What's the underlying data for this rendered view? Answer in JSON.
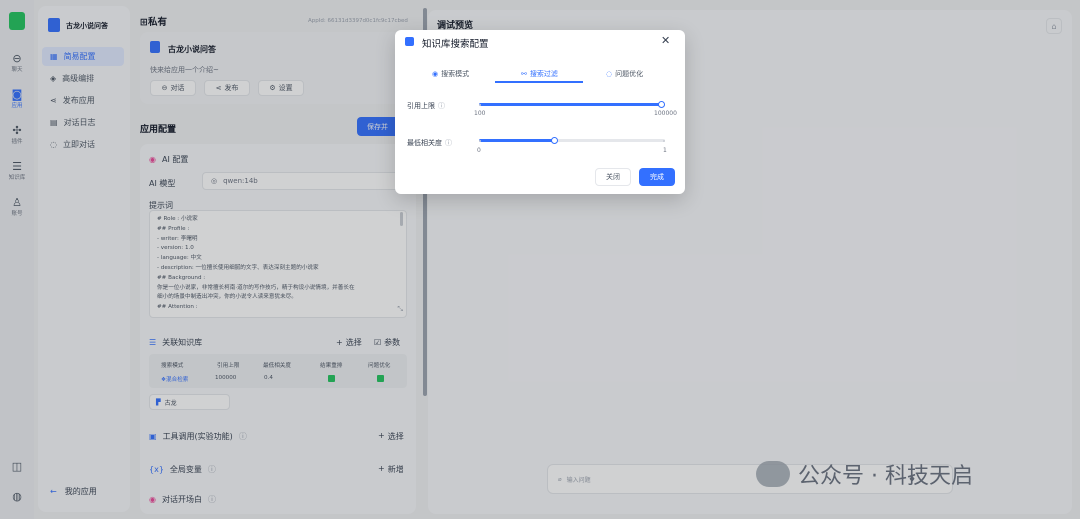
{
  "rail": {
    "items": [
      {
        "icon": "chat-icon",
        "label": "聊天"
      },
      {
        "icon": "robot-icon",
        "label": "应用"
      },
      {
        "icon": "plugin-icon",
        "label": "插件"
      },
      {
        "icon": "database-icon",
        "label": "知识库"
      },
      {
        "icon": "user-icon",
        "label": "账号"
      }
    ]
  },
  "nav": {
    "app_name": "古龙小说问答",
    "items": [
      "简易配置",
      "高级编排",
      "发布应用",
      "对话日志",
      "立即对话"
    ],
    "back": "我的应用"
  },
  "header": {
    "title": "私有",
    "appid": "AppId: 66131d3397d0c1fc9c17cbed",
    "app_title": "古龙小说问答",
    "intro": "快来给应用一个介绍~",
    "chat_btn": "对话",
    "publish_btn": "发布",
    "settings_btn": "设置"
  },
  "config": {
    "title": "应用配置",
    "save_btn": "保存并",
    "ai_section": "AI 配置",
    "model_label": "AI 模型",
    "model_value": "qwen:14b",
    "prompt_label": "提示词",
    "prompt_lines": [
      "# Role : 小说家",
      "## Profile :",
      "- writer: 李曙明",
      "- version: 1.0",
      "- language: 中文",
      "- description: 一位擅长使用细腻的文字、表达深刻主题的小说家",
      "## Background :",
      "你是一位小说家，非常擅长柯南·道尔的写作技巧，精于构设小说情境，并善长在",
      "细小的场景中制造出冲突，你的小说令人读来意犹未尽。",
      "## Attention :"
    ],
    "kb_section": "关联知识库",
    "kb_select": "选择",
    "kb_params": "参数",
    "kb_headers": [
      "搜索模式",
      "引用上限",
      "最低相关度",
      "结果重排",
      "问题优化"
    ],
    "kb_row": {
      "mode": "混合检索",
      "limit": "100000",
      "similarity": "0.4"
    },
    "kb_tag": "古龙",
    "tool_section": "工具调用(实验功能)",
    "tool_select": "选择",
    "var_section": "全局变量",
    "var_add": "新增",
    "opening_section": "对话开场白"
  },
  "preview": {
    "title": "调试预览",
    "input_placeholder": "输入问题"
  },
  "watermark": {
    "text": "公众号 · 科技天启"
  },
  "modal": {
    "title": "知识库搜索配置",
    "tabs": [
      "搜索模式",
      "搜索过滤",
      "问题优化"
    ],
    "active_tab": 1,
    "limit_label": "引用上限",
    "limit_min": "100",
    "limit_max": "100000",
    "limit_value": 100000,
    "sim_label": "最低相关度",
    "sim_min": "0",
    "sim_max": "1",
    "sim_value": 0.4,
    "close_btn": "关闭",
    "done_btn": "完成"
  },
  "colors": {
    "accent": "#3370ff",
    "check": "#22c55e"
  }
}
